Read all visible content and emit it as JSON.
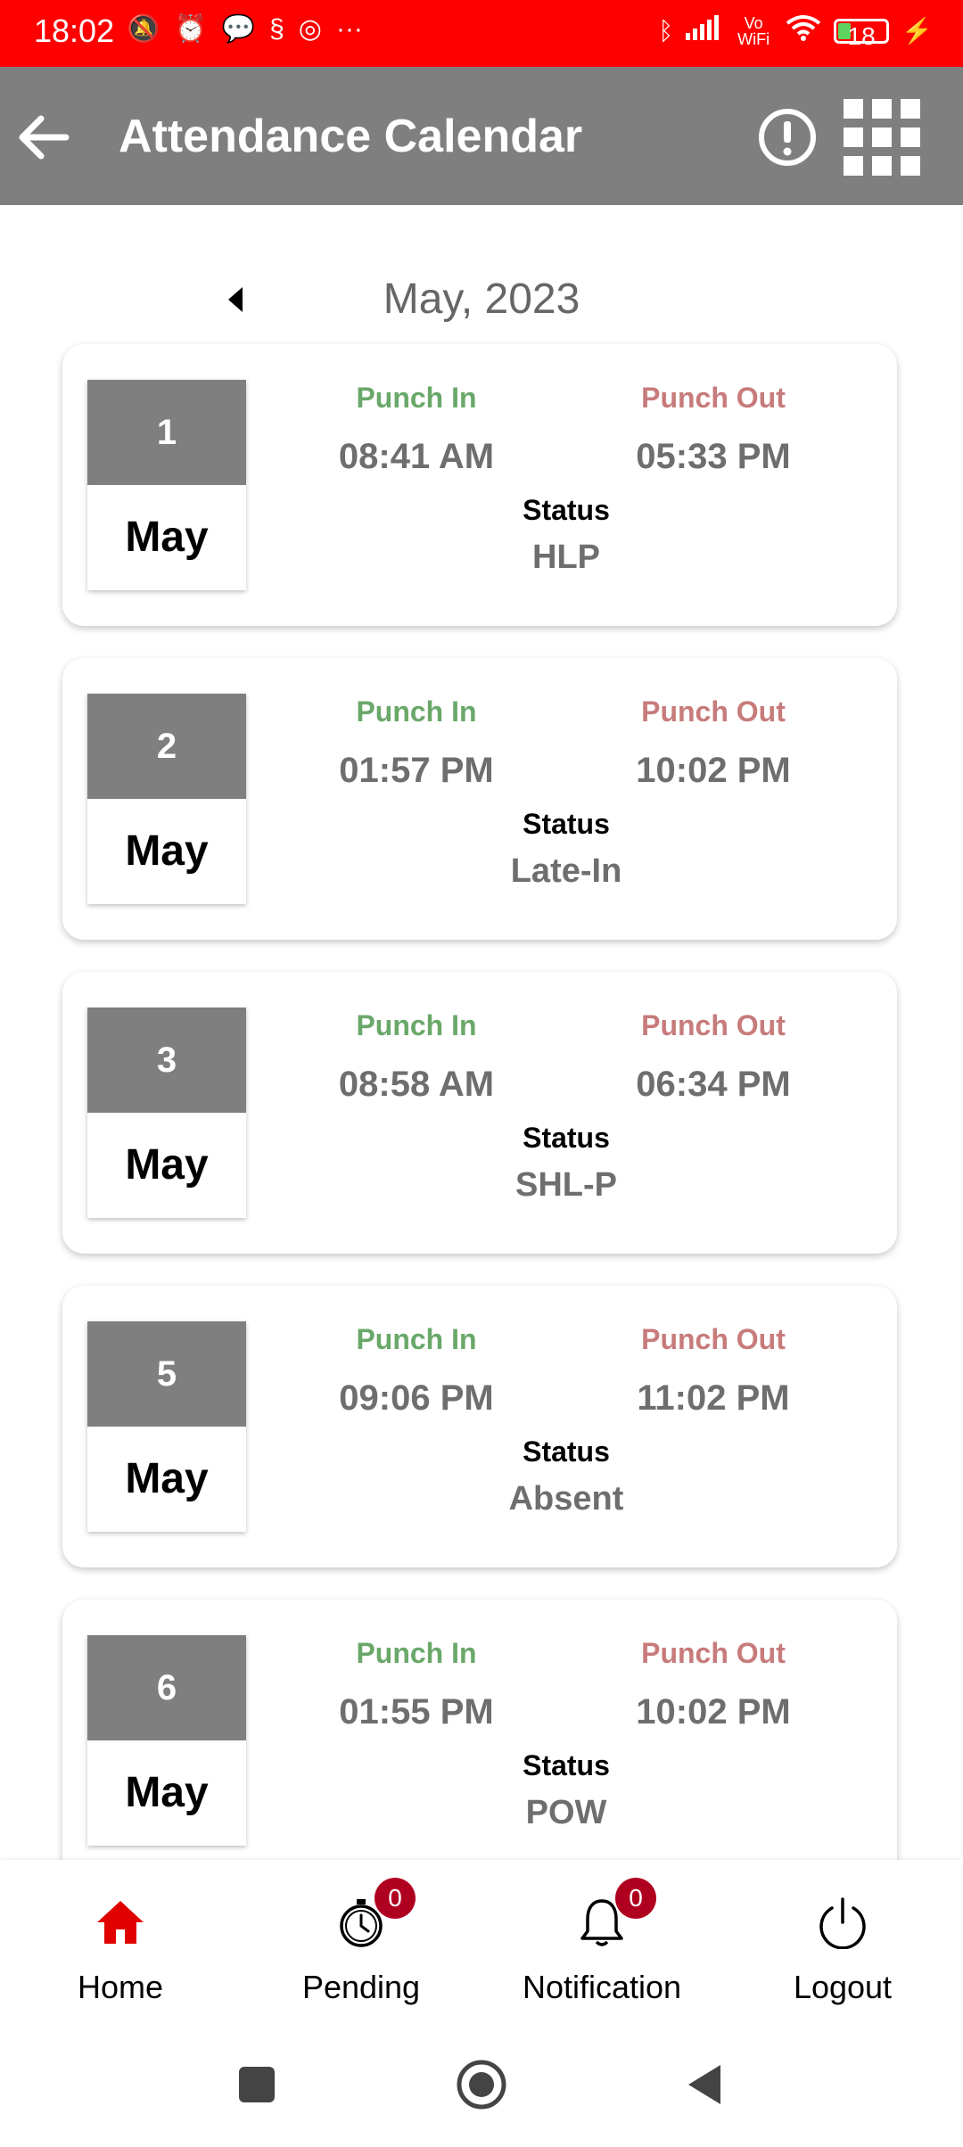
{
  "status_bar": {
    "time": "18:02",
    "left_icons": [
      "mute-icon",
      "alarm-icon",
      "chat-icon",
      "sim-icon",
      "instagram-icon",
      "more-icon"
    ],
    "right_icons": [
      "bluetooth-icon",
      "signal-icon",
      "vowifi-icon",
      "wifi-icon"
    ],
    "vowifi_text": "Vo WiFi",
    "battery_level": "18",
    "charging": true
  },
  "app_bar": {
    "title": "Attendance Calendar",
    "background": "#7f7f7f"
  },
  "calendar": {
    "month_label": "May, 2023"
  },
  "labels": {
    "punch_in": "Punch In",
    "punch_out": "Punch Out",
    "status": "Status"
  },
  "records": [
    {
      "day": "1",
      "month": "May",
      "punch_in": "08:41 AM",
      "punch_out": "05:33 PM",
      "status": "HLP"
    },
    {
      "day": "2",
      "month": "May",
      "punch_in": "01:57 PM",
      "punch_out": "10:02 PM",
      "status": "Late-In"
    },
    {
      "day": "3",
      "month": "May",
      "punch_in": "08:58 AM",
      "punch_out": "06:34 PM",
      "status": "SHL-P"
    },
    {
      "day": "5",
      "month": "May",
      "punch_in": "09:06 PM",
      "punch_out": "11:02 PM",
      "status": "Absent"
    },
    {
      "day": "6",
      "month": "May",
      "punch_in": "01:55 PM",
      "punch_out": "10:02 PM",
      "status": "POW"
    }
  ],
  "bottom_nav": {
    "items": [
      {
        "label": "Home",
        "icon": "home-icon",
        "active": true
      },
      {
        "label": "Pending",
        "icon": "stopwatch-icon",
        "badge": "0"
      },
      {
        "label": "Notification",
        "icon": "bell-icon",
        "badge": "0"
      },
      {
        "label": "Logout",
        "icon": "power-icon"
      }
    ]
  },
  "colors": {
    "status_bar": "#ff0000",
    "accent_red": "#e00000",
    "punch_in_green": "#6aa86a",
    "punch_out_red": "#c77b7b",
    "badge": "#b00020"
  }
}
